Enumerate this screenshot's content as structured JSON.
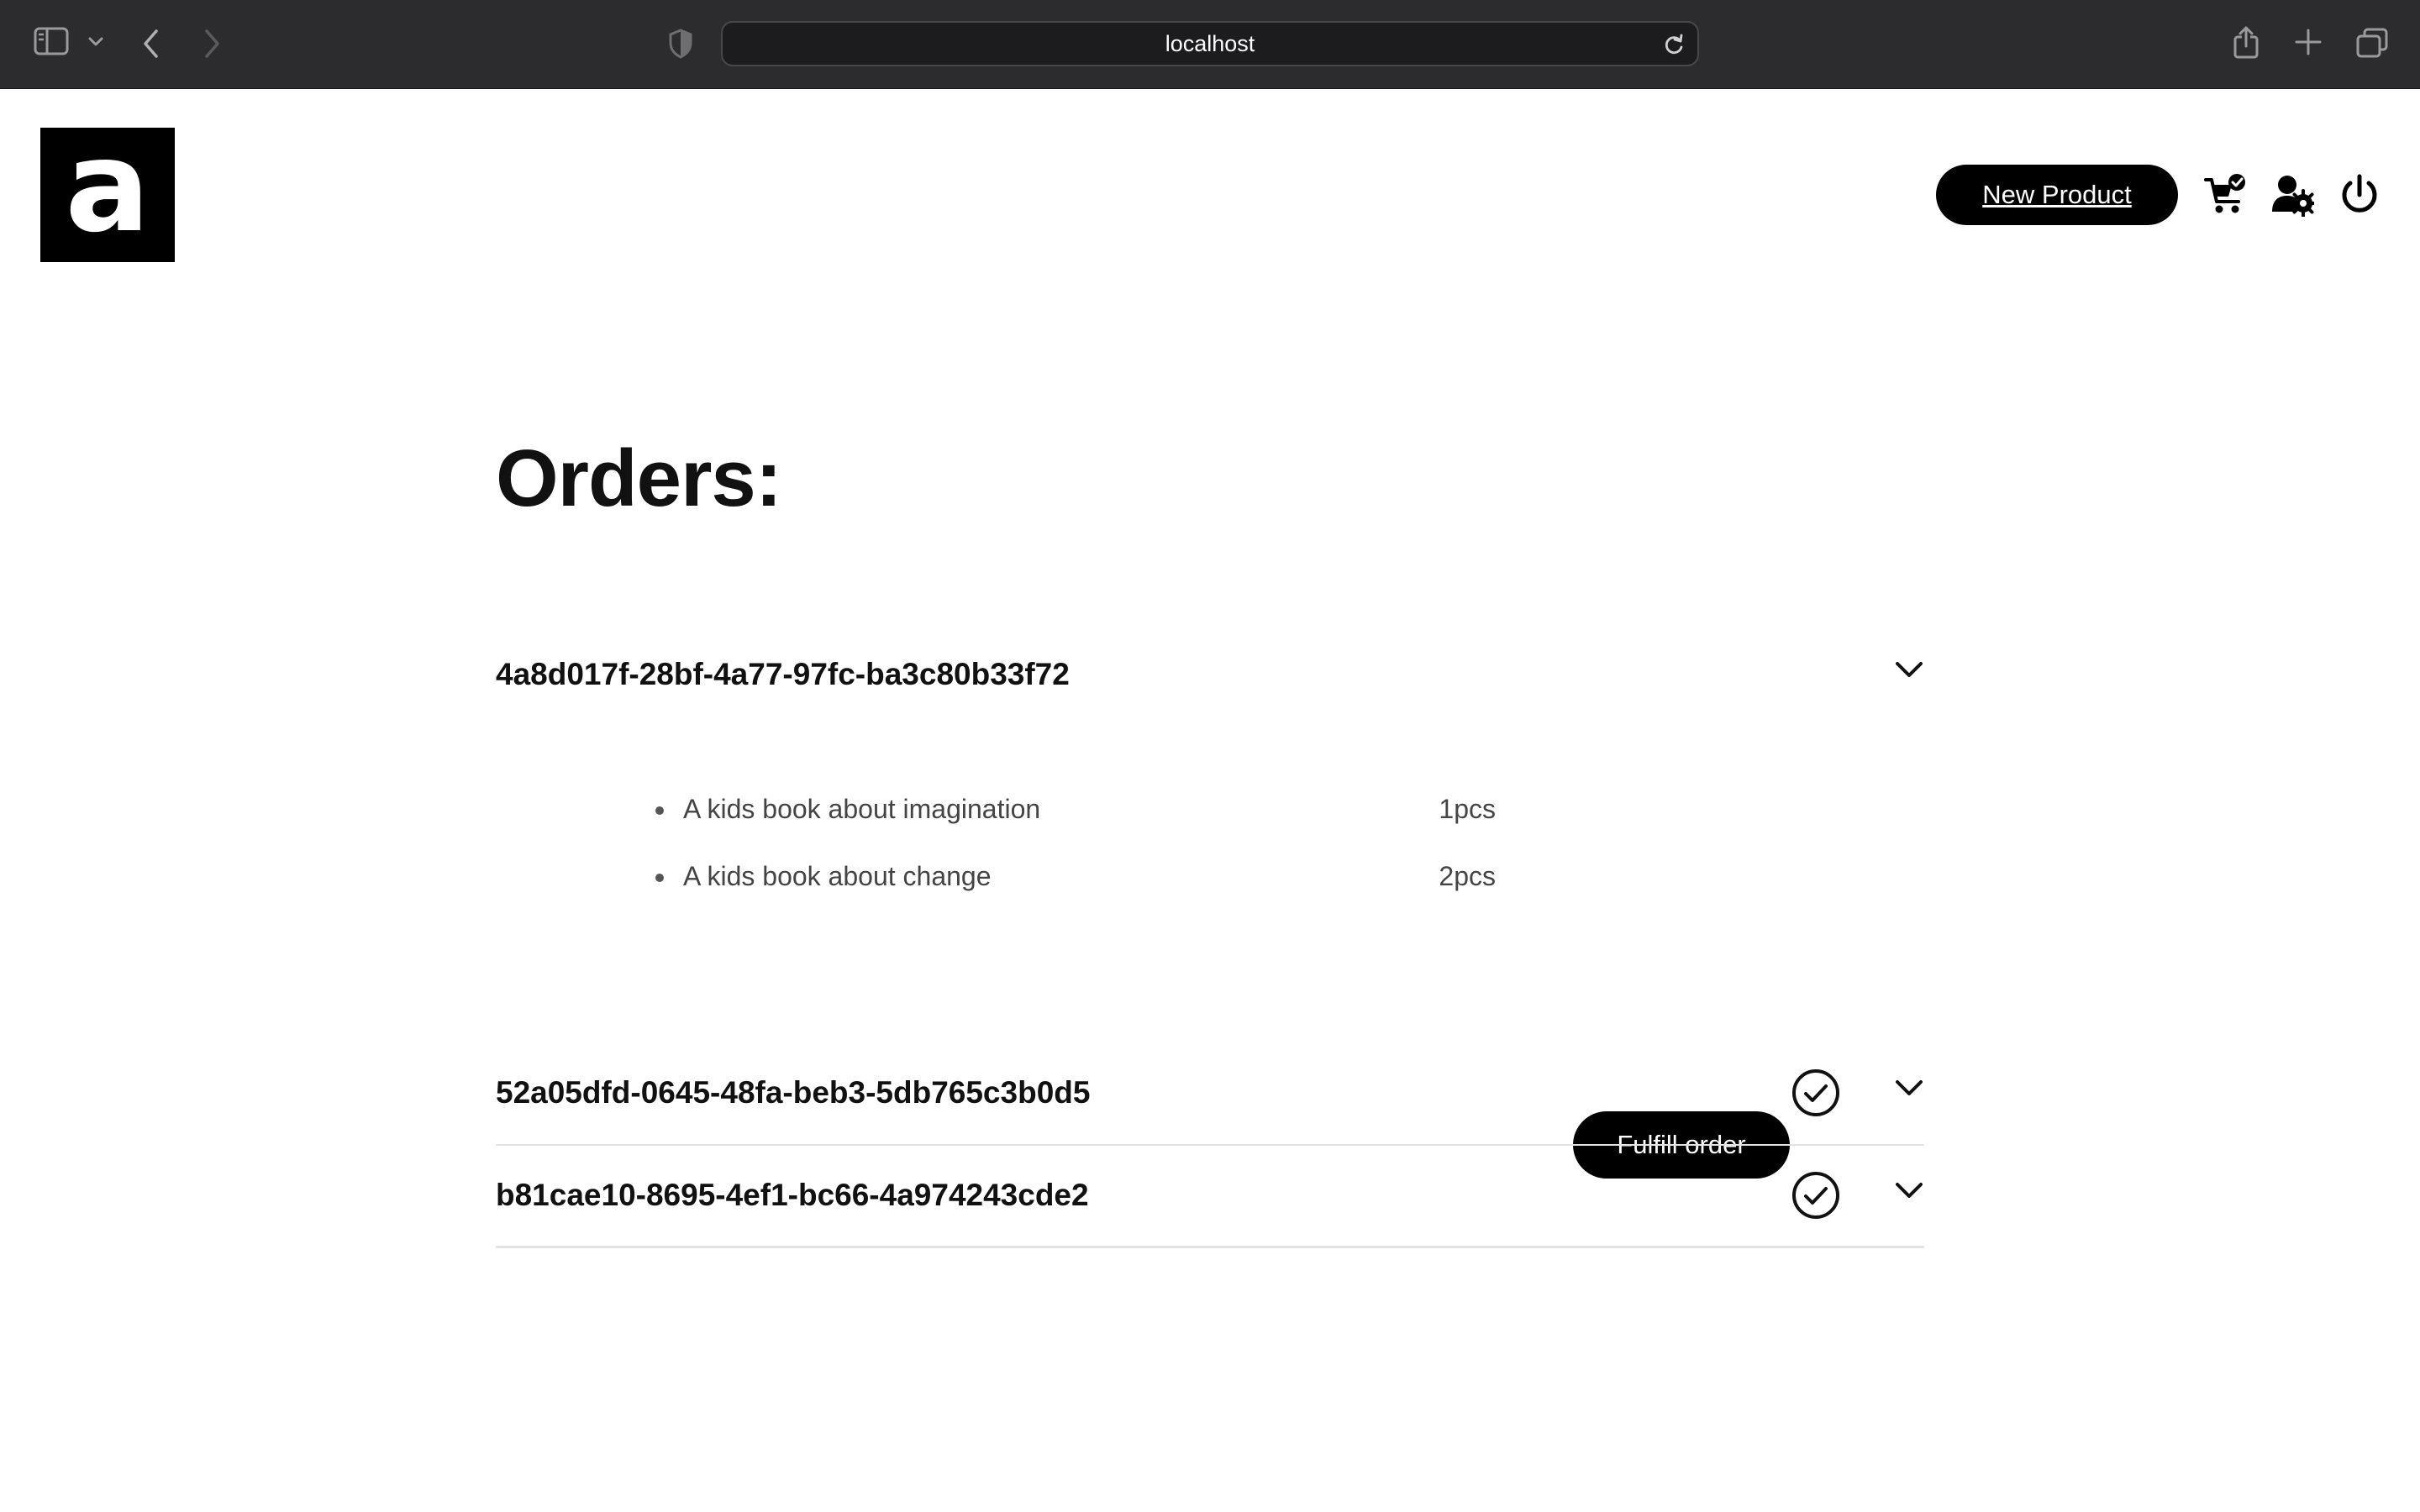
{
  "browser": {
    "url": "localhost"
  },
  "header": {
    "logo_letter": "a",
    "new_product_label": "New Product"
  },
  "page": {
    "title": "Orders:"
  },
  "orders": [
    {
      "id": "4a8d017f-28bf-4a77-97fc-ba3c80b33f72",
      "expanded": true,
      "fulfilled": false,
      "items": [
        {
          "name": "A kids book about imagination",
          "qty": "1pcs"
        },
        {
          "name": "A kids book about change",
          "qty": "2pcs"
        }
      ],
      "fulfill_label": "Fulfill order"
    },
    {
      "id": "52a05dfd-0645-48fa-beb3-5db765c3b0d5",
      "expanded": false,
      "fulfilled": true
    },
    {
      "id": "b81cae10-8695-4ef1-bc66-4a974243cde2",
      "expanded": false,
      "fulfilled": true
    }
  ]
}
